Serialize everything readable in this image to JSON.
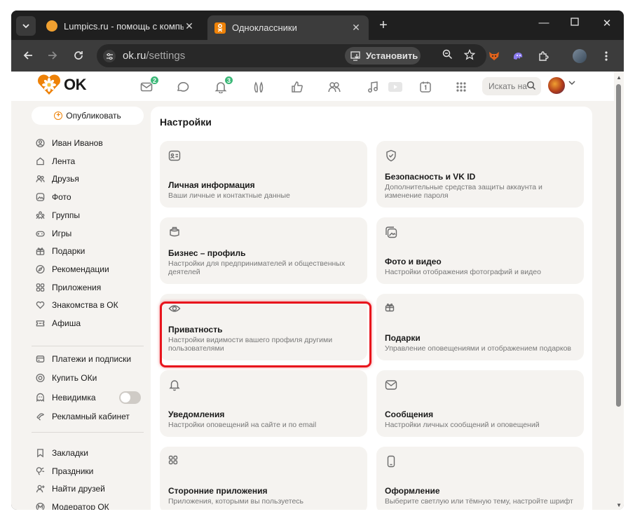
{
  "browser": {
    "tabs": [
      {
        "title": "Lumpics.ru - помощь с компь",
        "favicon_color": "#f0a030",
        "active": false
      },
      {
        "title": "Одноклассники",
        "favicon_color": "#ee8208",
        "active": true
      }
    ],
    "url_host": "ok.ru",
    "url_path": "/settings",
    "install_label": "Установить"
  },
  "header": {
    "logo_text": "OK",
    "search_placeholder": "Искать на",
    "messages_badge": "2",
    "notifications_badge": "3"
  },
  "sidebar": {
    "publish_label": "Опубликовать",
    "group1": [
      {
        "label": "Иван Иванов",
        "icon": "user-icon"
      },
      {
        "label": "Лента",
        "icon": "feed-icon"
      },
      {
        "label": "Друзья",
        "icon": "friends-icon"
      },
      {
        "label": "Фото",
        "icon": "photo-icon"
      },
      {
        "label": "Группы",
        "icon": "groups-icon"
      },
      {
        "label": "Игры",
        "icon": "games-icon"
      },
      {
        "label": "Подарки",
        "icon": "gift-icon"
      },
      {
        "label": "Рекомендации",
        "icon": "compass-icon"
      },
      {
        "label": "Приложения",
        "icon": "apps-icon"
      },
      {
        "label": "Знакомства в ОК",
        "icon": "heart-icon"
      },
      {
        "label": "Афиша",
        "icon": "ticket-icon"
      }
    ],
    "group2": [
      {
        "label": "Платежи и подписки",
        "icon": "payment-icon"
      },
      {
        "label": "Купить ОКи",
        "icon": "coin-icon"
      },
      {
        "label": "Невидимка",
        "icon": "invisible-icon"
      },
      {
        "label": "Рекламный кабинет",
        "icon": "megaphone-icon"
      }
    ],
    "group3": [
      {
        "label": "Закладки",
        "icon": "bookmark-icon"
      },
      {
        "label": "Праздники",
        "icon": "celebration-icon"
      },
      {
        "label": "Найти друзей",
        "icon": "add-user-icon"
      },
      {
        "label": "Модератор ОК",
        "icon": "moderator-icon"
      }
    ]
  },
  "settings": {
    "title": "Настройки",
    "cards": [
      {
        "title": "Личная информация",
        "desc": "Ваши личные и контактные данные",
        "icon": "id-card-icon"
      },
      {
        "title": "Безопасность и VK ID",
        "desc": "Дополнительные средства защиты аккаунта и изменение пароля",
        "icon": "shield-icon"
      },
      {
        "title": "Бизнес – профиль",
        "desc": "Настройки для предпринимателей и общественных деятелей",
        "icon": "business-icon"
      },
      {
        "title": "Фото и видео",
        "desc": "Настройки отображения фотографий и видео",
        "icon": "photos-icon"
      },
      {
        "title": "Приватность",
        "desc": "Настройки видимости вашего профиля другими пользователями",
        "icon": "eye-icon"
      },
      {
        "title": "Подарки",
        "desc": "Управление оповещениями и отображением подарков",
        "icon": "gift-icon"
      },
      {
        "title": "Уведомления",
        "desc": "Настройки оповещений на сайте и по email",
        "icon": "bell-icon"
      },
      {
        "title": "Сообщения",
        "desc": "Настройки личных сообщений и оповещений",
        "icon": "mail-icon"
      },
      {
        "title": "Сторонние приложения",
        "desc": "Приложения, которыми вы пользуетесь",
        "icon": "apps-icon"
      },
      {
        "title": "Оформление",
        "desc": "Выберите светлую или тёмную тему, настройте шрифт",
        "icon": "phone-icon"
      }
    ]
  },
  "colors": {
    "accent": "#ee8208",
    "highlight": "#e8141c",
    "badge": "#3cb878"
  }
}
